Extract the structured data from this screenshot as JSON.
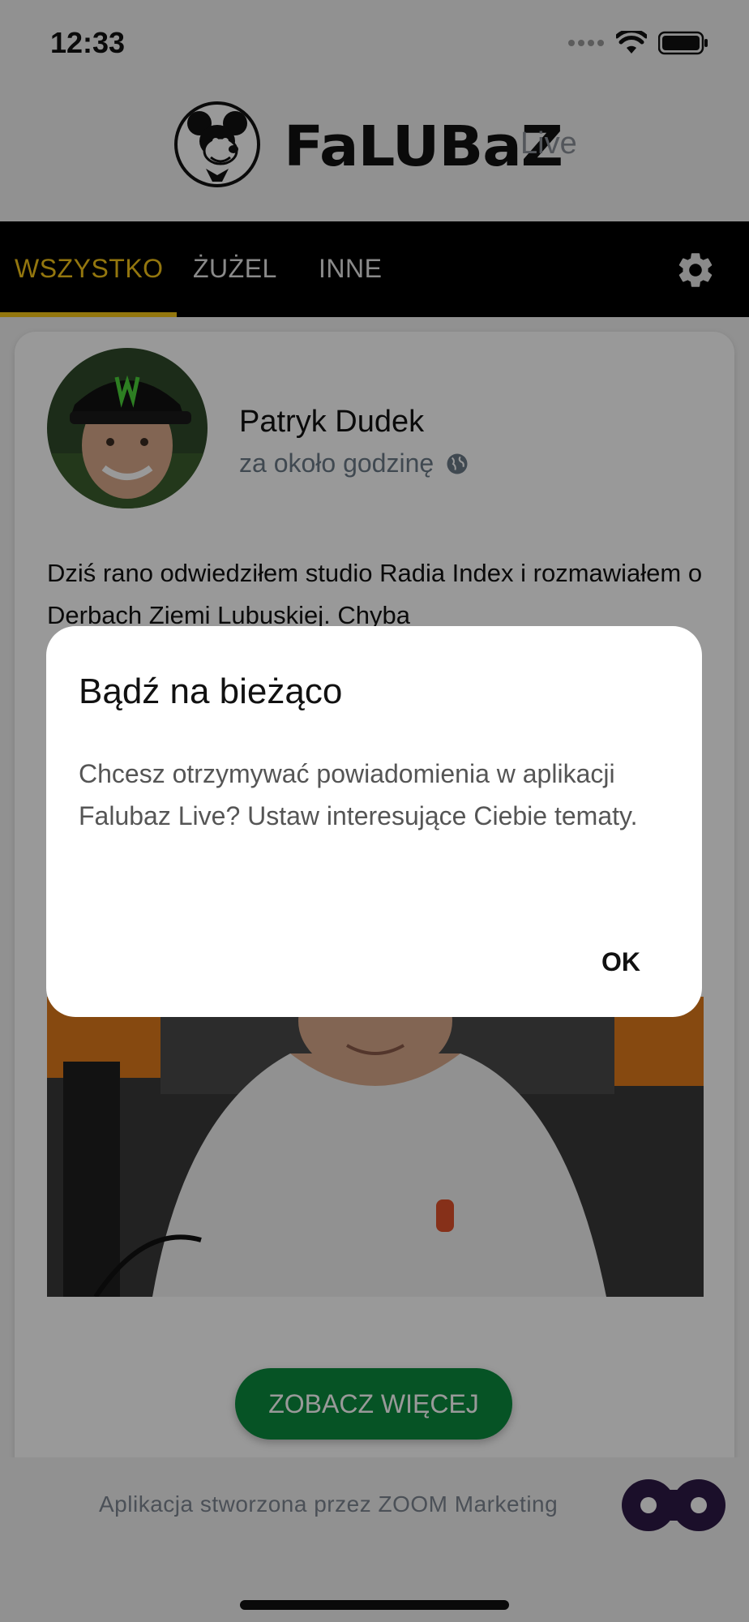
{
  "status_bar": {
    "time": "12:33"
  },
  "header": {
    "logo_text": "FaLUBaZ",
    "logo_sub": "Live"
  },
  "tabs": [
    {
      "label": "WSZYSTKO",
      "active": true
    },
    {
      "label": "ŻUŻEL",
      "active": false
    },
    {
      "label": "INNE",
      "active": false
    }
  ],
  "post": {
    "author": "Patryk Dudek",
    "time": "za około godzinę",
    "text": "Dziś rano odwiedziłem studio Radia Index i rozmawiałem o Derbach Ziemi Lubuskiej. Chyba"
  },
  "more_button": "ZOBACZ WIĘCEJ",
  "footer": {
    "text": "Aplikacja stworzona przez ZOOM Marketing"
  },
  "dialog": {
    "title": "Bądź na bieżąco",
    "body": "Chcesz otrzymywać powiadomienia w aplikacji Falubaz Live? Ustaw interesujące Ciebie tematy.",
    "ok_label": "OK"
  },
  "colors": {
    "accent": "#f5c518",
    "button_green": "#0a8a3e",
    "zoom_purple": "#2e1a47"
  }
}
